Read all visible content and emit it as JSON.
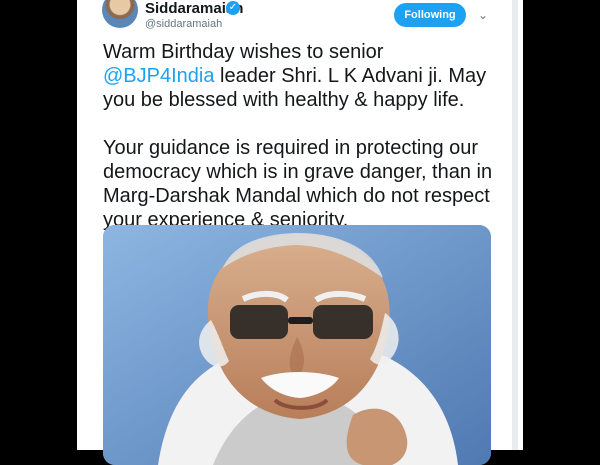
{
  "profile": {
    "name": "Siddaramaiah",
    "handle": "@siddaramaiah",
    "verified_icon": "✓",
    "follow_label": "Following",
    "menu_icon": "⌄"
  },
  "tweet": {
    "line1_pre": "Warm Birthday wishes to senior ",
    "mention": "@BJP4India",
    "line1_post": "leader Shri. L K Advani ji. May you be blessed with healthy & happy life.",
    "line2": "Your guidance is required in protecting our democracy which is in grave danger, than in Marg-Darshak Mandal which do not respect your experience & seniority."
  },
  "colors": {
    "accent": "#1da1f2",
    "text": "#14171a",
    "secondary": "#657786"
  }
}
